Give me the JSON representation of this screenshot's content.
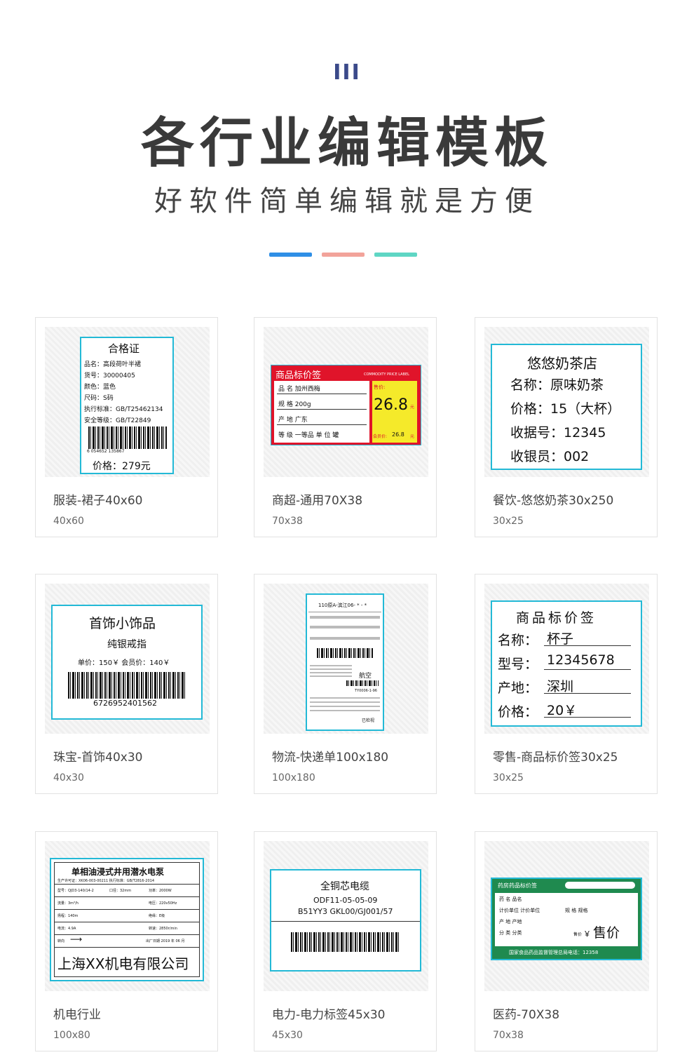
{
  "header": {
    "mark": "III",
    "title": "各行业编辑模板",
    "subtitle": "好软件简单编辑就是方便",
    "accent_colors": [
      "#2f8fe6",
      "#f2a39a",
      "#5fd6c4"
    ]
  },
  "cards": [
    {
      "title": "服装-裙子40x60",
      "size": "40x60",
      "label": {
        "heading": "合格证",
        "rows": [
          "品名：高段荷叶半裙",
          "货号：30000405",
          "颜色：蓝色",
          "尺码：S码",
          "执行标准：GB/T25462134",
          "安全等级：GB/T22849"
        ],
        "barcode_num": "6   054652        135867",
        "price": "价格：279元"
      }
    },
    {
      "title": "商超-通用70X38",
      "size": "70x38",
      "label": {
        "heading": "商品标价签",
        "heading_en": "COMMODITY PRICE LABEL",
        "rows": [
          "品  名  加州西梅",
          "规  格  200g",
          "产  地  广东",
          "等  级  一等品  单 位  罐"
        ],
        "price_tag": "售价:",
        "price": "26.8",
        "price_unit": "元",
        "member": "会员价:",
        "member_price": "26.8",
        "member_unit": "元"
      }
    },
    {
      "title": "餐饮-悠悠奶茶30x250",
      "size": "30x25",
      "label": {
        "heading": "悠悠奶茶店",
        "rows": [
          "名称：原味奶茶",
          "价格：15（大杯）",
          "收据号：12345",
          "收银员：002"
        ]
      }
    },
    {
      "title": "珠宝-首饰40x30",
      "size": "40x30",
      "label": {
        "heading": "首饰小饰品",
        "sub": "纯银戒指",
        "price_line": "单价：150￥  会员价：140￥",
        "barcode_num": "6726952401562"
      }
    },
    {
      "title": "物流-快递单100x180",
      "size": "100x180",
      "label": {
        "route": "110原A-滨江06- * - *",
        "service": "航空",
        "code": "TY0006-1-96",
        "tag": "已检视"
      }
    },
    {
      "title": "零售-商品标价签30x25",
      "size": "30x25",
      "label": {
        "heading": "商品标价签",
        "rows": [
          {
            "k": "名称：",
            "v": "杯子"
          },
          {
            "k": "型号：",
            "v": "12345678"
          },
          {
            "k": "产地：",
            "v": "深圳"
          },
          {
            "k": "价格：",
            "v": "20￥"
          }
        ]
      }
    },
    {
      "title": "机电行业",
      "size": "100x80",
      "label": {
        "heading": "单相油浸式井用潜水电泵",
        "meta": "生产许可证：XK06-003-00211    执行标准：GB/T2816-2014",
        "grid": [
          "型号：QJD3-140/14-2",
          "口径：32mm",
          "功率：2000W",
          "流量：3m³/h",
          "电压：220v50Hz",
          "扬程：140m",
          "绝缘：E级",
          "电流：4.9A",
          "转速：2850r/min"
        ],
        "rotation": "转向",
        "date": "出厂日期 2019 年 06 月",
        "company": "上海XX机电有限公司"
      }
    },
    {
      "title": "电力-电力标签45x30",
      "size": "45x30",
      "label": {
        "heading": "全铜芯电缆",
        "line1": "ODF11-05-05-09",
        "line2": "B51YY3 GKL00/GJ001/57"
      }
    },
    {
      "title": "医药-70X38",
      "size": "70x38",
      "label": {
        "heading": "药房药品标价签",
        "rows": [
          "药  名  品名",
          "计价单位  计价单位",
          "产  地  产地",
          "分  类  分类"
        ],
        "spec": "规  格  规格",
        "price_mark": "售价",
        "price_sign": "￥",
        "price": "售价",
        "footer": "国家食品药品监督管理总局电话：12358",
        "colors": {
          "green": "#1f8a4f"
        }
      }
    }
  ]
}
